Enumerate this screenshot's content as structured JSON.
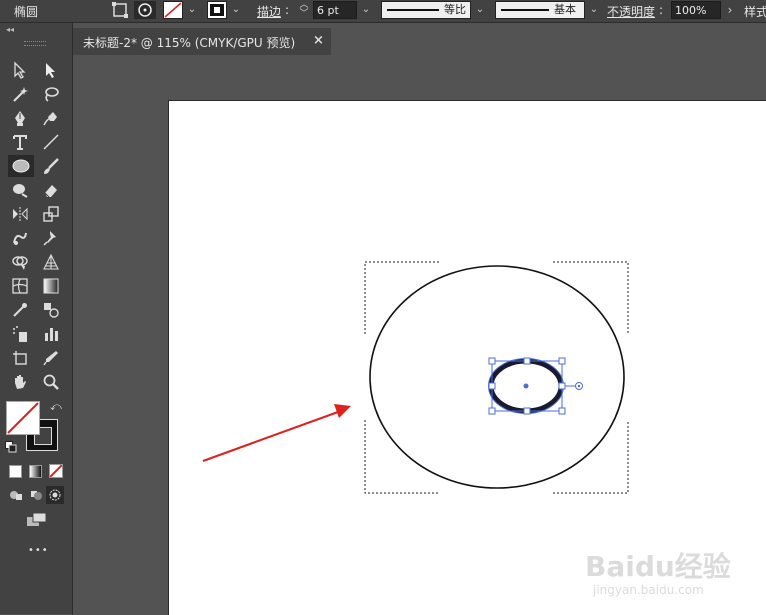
{
  "control_bar": {
    "object_type": "椭圆",
    "stroke_label": "描边",
    "stroke_weight": "6 pt",
    "profile_label": "等比",
    "brush_label": "基本",
    "opacity_label": "不透明度",
    "opacity_value": "100%",
    "style_label": "样式"
  },
  "document_tab": {
    "title": "未标题-2* @ 115% (CMYK/GPU 预览)",
    "close": "×"
  },
  "tools_panel": {
    "collapse_glyph": "◂◂",
    "more_glyph": "•••"
  },
  "colors": {
    "ui_dark": "#424242",
    "ui_mid": "#535353",
    "selection_blue": "#4a6fd8",
    "arrow_red": "#e0201c",
    "ellipse_fill": "#1a1a2e"
  },
  "watermark": {
    "brand": "Baidu经验",
    "url": "jingyan.baidu.com"
  }
}
